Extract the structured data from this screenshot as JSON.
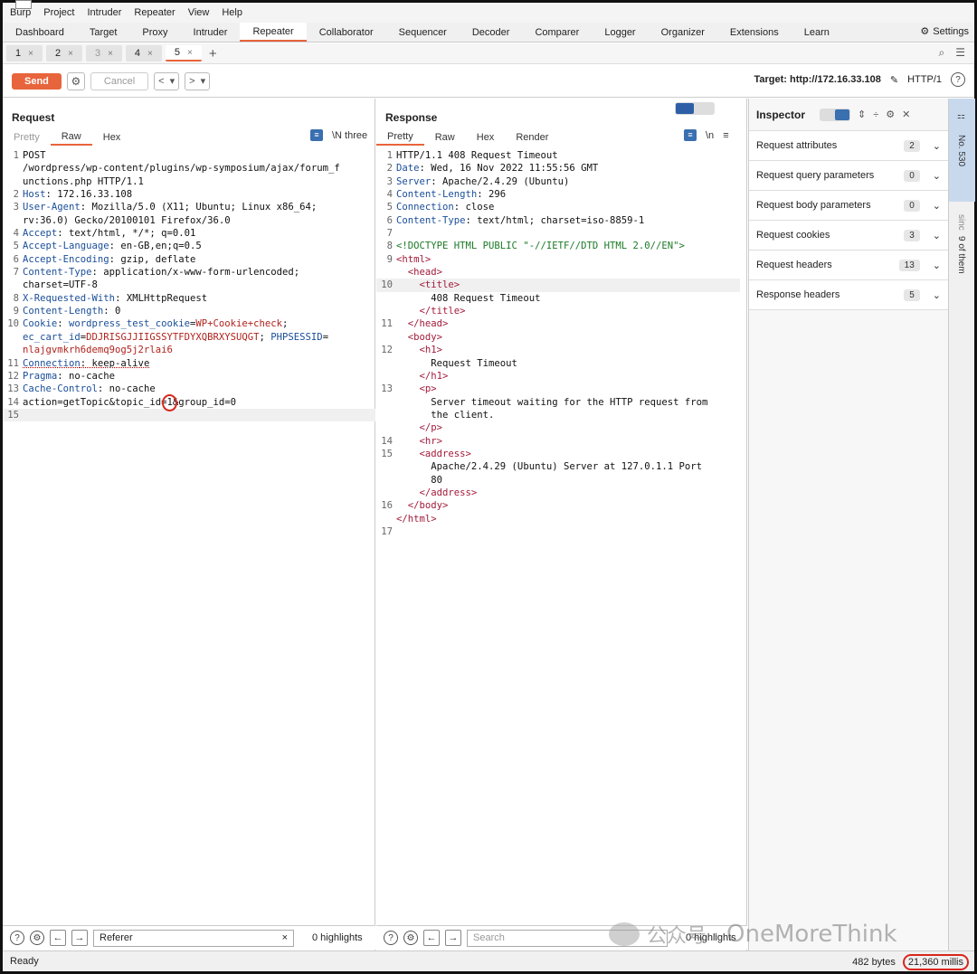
{
  "menu": [
    "Burp",
    "Project",
    "Intruder",
    "Repeater",
    "View",
    "Help"
  ],
  "tool_tabs": [
    "Dashboard",
    "Target",
    "Proxy",
    "Intruder",
    "Repeater",
    "Collaborator",
    "Sequencer",
    "Decoder",
    "Comparer",
    "Logger",
    "Organizer",
    "Extensions",
    "Learn"
  ],
  "active_tool_tab": "Repeater",
  "settings_label": "Settings",
  "request_tabs": [
    {
      "label": "1",
      "close": "×"
    },
    {
      "label": "2",
      "close": "×"
    },
    {
      "label": "3",
      "close": "×"
    },
    {
      "label": "4",
      "close": "×"
    },
    {
      "label": "5",
      "close": "×"
    }
  ],
  "add_tab": "+",
  "toolbar": {
    "send": "Send",
    "cancel": "Cancel",
    "back": "<",
    "forward": ">",
    "target_label": "Target: http://172.16.33.108",
    "http_version": "HTTP/1"
  },
  "request": {
    "title": "Request",
    "tabs": [
      "Pretty",
      "Raw",
      "Hex"
    ],
    "active_tab": "Raw",
    "newline_toggle": "\\N three",
    "lines": [
      {
        "n": "1",
        "parts": [
          [
            "",
            "POST"
          ]
        ]
      },
      {
        "n": "",
        "parts": [
          [
            "",
            "/wordpress/wp-content/plugins/wp-symposium/ajax/forum_f"
          ]
        ]
      },
      {
        "n": "",
        "parts": [
          [
            "",
            "unctions.php HTTP/1.1"
          ]
        ]
      },
      {
        "n": "2",
        "parts": [
          [
            "hk",
            "Host"
          ],
          [
            "",
            ": 172.16.33.108"
          ]
        ]
      },
      {
        "n": "3",
        "parts": [
          [
            "hk",
            "User-Agent"
          ],
          [
            "",
            ": Mozilla/5.0 (X11; Ubuntu; Linux x86_64;"
          ]
        ]
      },
      {
        "n": "",
        "parts": [
          [
            "",
            "rv:36.0) Gecko/20100101 Firefox/36.0"
          ]
        ]
      },
      {
        "n": "4",
        "parts": [
          [
            "hk",
            "Accept"
          ],
          [
            "",
            ": text/html, */*; q=0.01"
          ]
        ]
      },
      {
        "n": "5",
        "parts": [
          [
            "hk",
            "Accept-Language"
          ],
          [
            "",
            ": en-GB,en;q=0.5"
          ]
        ]
      },
      {
        "n": "6",
        "parts": [
          [
            "hk",
            "Accept-Encoding"
          ],
          [
            "",
            ": gzip, deflate"
          ]
        ]
      },
      {
        "n": "7",
        "parts": [
          [
            "hk",
            "Content-Type"
          ],
          [
            "",
            ": application/x-www-form-urlencoded;"
          ]
        ]
      },
      {
        "n": "",
        "parts": [
          [
            "",
            "charset=UTF-8"
          ]
        ]
      },
      {
        "n": "8",
        "parts": [
          [
            "hk",
            "X-Requested-With"
          ],
          [
            "",
            ": XMLHttpRequest"
          ]
        ]
      },
      {
        "n": "9",
        "parts": [
          [
            "hk",
            "Content-Length"
          ],
          [
            "",
            ": 0"
          ]
        ]
      },
      {
        "n": "10",
        "parts": [
          [
            "hk",
            "Cookie"
          ],
          [
            "",
            ": "
          ],
          [
            "blu",
            "wordpress_test_cookie"
          ],
          [
            "",
            "="
          ],
          [
            "red",
            "WP+Cookie+check"
          ],
          [
            "",
            ";"
          ]
        ]
      },
      {
        "n": "",
        "parts": [
          [
            "blu",
            "ec_cart_id"
          ],
          [
            "",
            "="
          ],
          [
            "red",
            "DDJRISGJJIIGSSYTFDYXQBRXYSUQGT"
          ],
          [
            "",
            "; "
          ],
          [
            "blu",
            "PHPSESSID"
          ],
          [
            "",
            "="
          ]
        ]
      },
      {
        "n": "",
        "parts": [
          [
            "red",
            "nlajgvmkrh6demq9og5j2rlai6"
          ]
        ]
      },
      {
        "n": "11",
        "parts": [
          [
            "hk und",
            "Connection"
          ],
          [
            "und",
            ": keep-alive"
          ]
        ]
      },
      {
        "n": "12",
        "parts": [
          [
            "hk",
            "Pragma"
          ],
          [
            "",
            ": no-cache"
          ]
        ]
      },
      {
        "n": "13",
        "parts": [
          [
            "hk",
            "Cache-Control"
          ],
          [
            "",
            ": no-cache"
          ]
        ]
      },
      {
        "n": "14",
        "parts": [
          [
            "",
            "action=getTopic&topic_id="
          ],
          [
            "circle",
            "1&"
          ],
          [
            "",
            "group_id=0"
          ]
        ]
      },
      {
        "n": "15",
        "parts": [
          [
            "",
            ""
          ]
        ],
        "hl": true
      }
    ],
    "search_value": "Referer",
    "search_clear": "×",
    "highlights": "0 highlights"
  },
  "response": {
    "title": "Response",
    "tabs": [
      "Pretty",
      "Raw",
      "Hex",
      "Render"
    ],
    "active_tab": "Pretty",
    "newline_toggle": "\\n",
    "lines": [
      {
        "n": "1",
        "parts": [
          [
            "",
            "HTTP/1.1 408 Request Timeout"
          ]
        ]
      },
      {
        "n": "2",
        "parts": [
          [
            "hk",
            "Date"
          ],
          [
            "",
            ": Wed, 16 Nov 2022 11:55:56 GMT"
          ]
        ]
      },
      {
        "n": "3",
        "parts": [
          [
            "hk",
            "Server"
          ],
          [
            "",
            ": Apache/2.4.29 (Ubuntu)"
          ]
        ]
      },
      {
        "n": "4",
        "parts": [
          [
            "hk",
            "Content-Length"
          ],
          [
            "",
            ": 296"
          ]
        ]
      },
      {
        "n": "5",
        "parts": [
          [
            "hk",
            "Connection"
          ],
          [
            "",
            ": close"
          ]
        ]
      },
      {
        "n": "6",
        "parts": [
          [
            "hk",
            "Content-Type"
          ],
          [
            "",
            ": text/html; charset=iso-8859-1"
          ]
        ]
      },
      {
        "n": "7",
        "parts": [
          [
            "",
            ""
          ]
        ]
      },
      {
        "n": "8",
        "parts": [
          [
            "dt",
            "<!DOCTYPE HTML PUBLIC \"-//IETF//DTD HTML 2.0//EN\">"
          ]
        ]
      },
      {
        "n": "9",
        "parts": [
          [
            "tag",
            "<html>"
          ]
        ]
      },
      {
        "n": "",
        "parts": [
          [
            "",
            "  "
          ],
          [
            "tag",
            "<head>"
          ]
        ]
      },
      {
        "n": "10",
        "parts": [
          [
            "",
            "    "
          ],
          [
            "tag",
            "<title>"
          ]
        ],
        "hl": true
      },
      {
        "n": "",
        "parts": [
          [
            "",
            "      408 Request Timeout"
          ]
        ]
      },
      {
        "n": "",
        "parts": [
          [
            "",
            "    "
          ],
          [
            "tag",
            "</title>"
          ]
        ]
      },
      {
        "n": "11",
        "parts": [
          [
            "",
            "  "
          ],
          [
            "tag",
            "</head>"
          ]
        ]
      },
      {
        "n": "",
        "parts": [
          [
            "",
            "  "
          ],
          [
            "tag",
            "<body>"
          ]
        ]
      },
      {
        "n": "12",
        "parts": [
          [
            "",
            "    "
          ],
          [
            "tag",
            "<h1>"
          ]
        ]
      },
      {
        "n": "",
        "parts": [
          [
            "",
            "      Request Timeout"
          ]
        ]
      },
      {
        "n": "",
        "parts": [
          [
            "",
            "    "
          ],
          [
            "tag",
            "</h1>"
          ]
        ]
      },
      {
        "n": "13",
        "parts": [
          [
            "",
            "    "
          ],
          [
            "tag",
            "<p>"
          ]
        ]
      },
      {
        "n": "",
        "parts": [
          [
            "",
            "      Server timeout waiting for the HTTP request from"
          ]
        ]
      },
      {
        "n": "",
        "parts": [
          [
            "",
            "      the client."
          ]
        ]
      },
      {
        "n": "",
        "parts": [
          [
            "",
            "    "
          ],
          [
            "tag",
            "</p>"
          ]
        ]
      },
      {
        "n": "14",
        "parts": [
          [
            "",
            "    "
          ],
          [
            "tag",
            "<hr>"
          ]
        ]
      },
      {
        "n": "15",
        "parts": [
          [
            "",
            "    "
          ],
          [
            "tag",
            "<address>"
          ]
        ]
      },
      {
        "n": "",
        "parts": [
          [
            "",
            "      Apache/2.4.29 (Ubuntu) Server at 127.0.1.1 Port"
          ]
        ]
      },
      {
        "n": "",
        "parts": [
          [
            "",
            "      80"
          ]
        ]
      },
      {
        "n": "",
        "parts": [
          [
            "",
            "    "
          ],
          [
            "tag",
            "</address>"
          ]
        ]
      },
      {
        "n": "16",
        "parts": [
          [
            "",
            "  "
          ],
          [
            "tag",
            "</body>"
          ]
        ]
      },
      {
        "n": "",
        "parts": [
          [
            "tag",
            "</html>"
          ]
        ]
      },
      {
        "n": "17",
        "parts": [
          [
            "",
            ""
          ]
        ]
      }
    ],
    "search_placeholder": "Search",
    "highlights": "0 highlights"
  },
  "inspector": {
    "title": "Inspector",
    "rows": [
      {
        "label": "Request attributes",
        "count": "2"
      },
      {
        "label": "Request query parameters",
        "count": "0"
      },
      {
        "label": "Request body parameters",
        "count": "0"
      },
      {
        "label": "Request cookies",
        "count": "3"
      },
      {
        "label": "Request headers",
        "count": "13"
      },
      {
        "label": "Response headers",
        "count": "5"
      }
    ]
  },
  "side_strip": {
    "item1": "No. 530",
    "item2": "sinc",
    "item3": "9 of them"
  },
  "status": {
    "left": "Ready",
    "bytes": "482 bytes",
    "millis": "21,360 millis"
  },
  "watermark": {
    "cn": "公众号 ·",
    "en": "OneMoreThink"
  },
  "colors": {
    "accent": "#e8643c",
    "selected_blue": "#3a6fb0",
    "annotation_red": "#d9261c"
  }
}
